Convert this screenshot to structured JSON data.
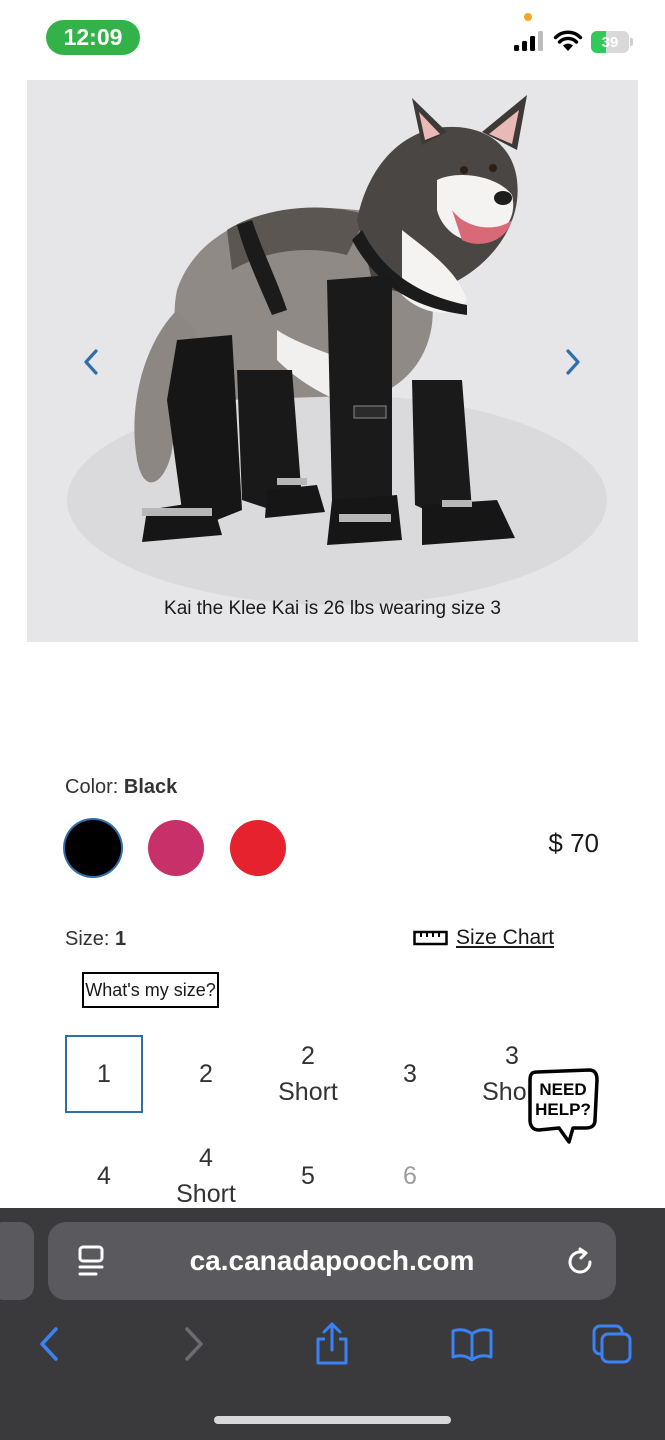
{
  "status_bar": {
    "time": "12:09",
    "battery_level": "39",
    "battery_fraction": 0.39,
    "colors": {
      "time_pill": "#34b24a",
      "battery": "#34c759",
      "recording_dot": "#f5a623"
    }
  },
  "gallery": {
    "caption": "Kai the Klee Kai is 26 lbs wearing size 3",
    "prev_icon": "chevron-left-icon",
    "next_icon": "chevron-right-icon",
    "arrow_color": "#2f6ea8"
  },
  "product": {
    "color_prefix": "Color:",
    "color_value": "Black",
    "swatches": [
      {
        "name": "Black",
        "hex": "#000000",
        "selected": true
      },
      {
        "name": "Pink",
        "hex": "#c8306a",
        "selected": false
      },
      {
        "name": "Red",
        "hex": "#e6222e",
        "selected": false
      }
    ],
    "price": "$ 70",
    "size_prefix": "Size:",
    "size_value": "1",
    "size_chart_label": "Size Chart",
    "size_chart_icon": "ruler-icon",
    "whats_my_size_label": "What's my size?",
    "sizes": [
      {
        "line1": "1",
        "line2": ""
      },
      {
        "line1": "2",
        "line2": ""
      },
      {
        "line1": "2",
        "line2": "Short"
      },
      {
        "line1": "3",
        "line2": ""
      },
      {
        "line1": "3",
        "line2": "Short"
      },
      {
        "line1": "4",
        "line2": ""
      },
      {
        "line1": "4",
        "line2": "Short"
      },
      {
        "line1": "5",
        "line2": ""
      },
      {
        "line1": "6",
        "line2": ""
      }
    ],
    "selected_size": "1"
  },
  "help_widget": {
    "line1": "NEED",
    "line2": "HELP?"
  },
  "browser": {
    "url": "ca.canadapooch.com",
    "page_settings_icon": "page-settings-icon",
    "reload_icon": "reload-icon",
    "toolbar_icons": [
      "back-icon",
      "forward-icon",
      "share-icon",
      "bookmarks-icon",
      "tabs-icon"
    ],
    "accent_color": "#3b82f6"
  }
}
